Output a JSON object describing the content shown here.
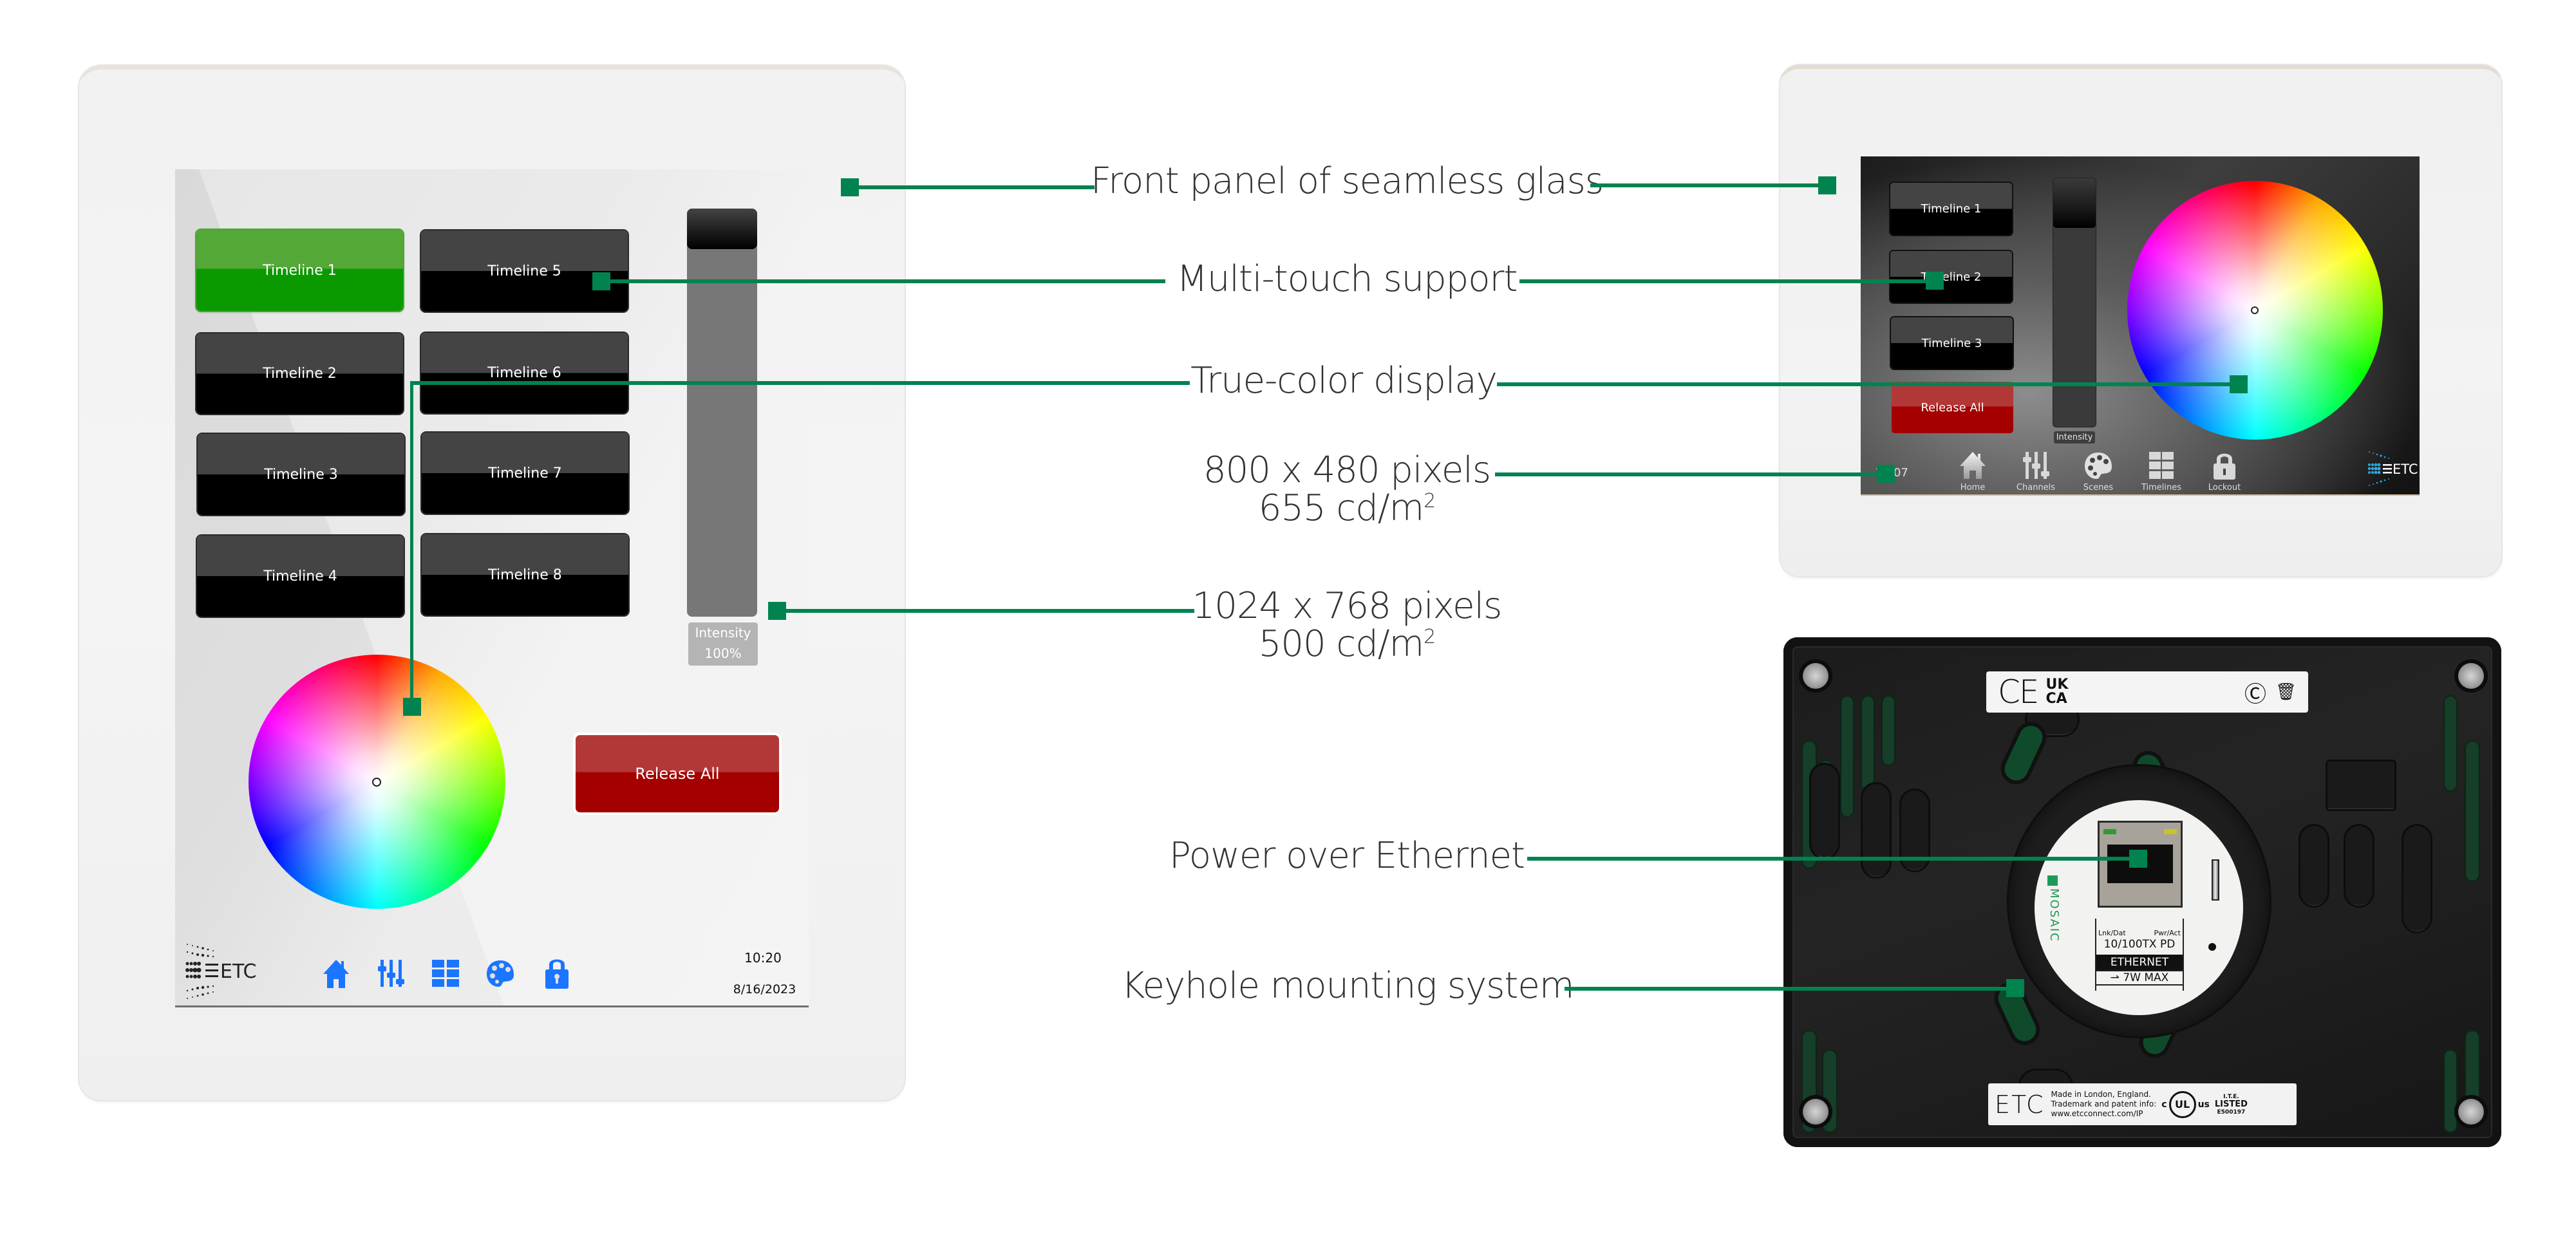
{
  "callouts": {
    "front_panel": "Front panel of seamless glass",
    "multi_touch": "Multi-touch support",
    "true_color": "True-color display",
    "small_res_line1": "800 x 480 pixels",
    "small_res_line2": "655 cd/m",
    "small_res_sup": "2",
    "large_res_line1": "1024 x 768 pixels",
    "large_res_line2": "500 cd/m",
    "large_res_sup": "2",
    "poe": "Power over Ethernet",
    "keyhole": "Keyhole mounting system"
  },
  "accent_color": "#00834f",
  "left_device": {
    "timelines": [
      {
        "label": "Timeline 1",
        "active": true
      },
      {
        "label": "Timeline 2",
        "active": false
      },
      {
        "label": "Timeline 3",
        "active": false
      },
      {
        "label": "Timeline 4",
        "active": false
      },
      {
        "label": "Timeline 5",
        "active": false
      },
      {
        "label": "Timeline 6",
        "active": false
      },
      {
        "label": "Timeline 7",
        "active": false
      },
      {
        "label": "Timeline 8",
        "active": false
      }
    ],
    "intensity_label": "Intensity",
    "intensity_value": "100%",
    "intensity_fraction": 1.0,
    "release_all": "Release All",
    "logo": "ETC",
    "nav_icons": [
      "home-icon",
      "channels-sliders-icon",
      "timelines-grid-icon",
      "scenes-palette-icon",
      "lockout-lock-icon"
    ],
    "time": "10:20",
    "date": "8/16/2023",
    "nav_color": "#1a75ff",
    "active_color": "#0a9a00",
    "release_color": "#a50000"
  },
  "right_device": {
    "timelines": [
      "Timeline 1",
      "Timeline 2",
      "Timeline 3"
    ],
    "release_all": "Release All",
    "intensity_label": "Intensity",
    "time": "12:07",
    "nav": [
      {
        "icon": "home-icon",
        "label": "Home"
      },
      {
        "icon": "channels-sliders-icon",
        "label": "Channels"
      },
      {
        "icon": "scenes-palette-icon",
        "label": "Scenes"
      },
      {
        "icon": "timelines-grid-icon",
        "label": "Timelines"
      },
      {
        "icon": "lockout-lock-icon",
        "label": "Lockout"
      }
    ],
    "logo": "ETC"
  },
  "back_panel": {
    "top_label": {
      "ce": "CE",
      "ukca_line1": "UK",
      "ukca_line2": "CA"
    },
    "mosaic_brand": "MOSAIC",
    "eth_indicators": {
      "left": "Lnk/Dat",
      "right": "Pwr/Act"
    },
    "eth_spec": "10/100TX PD",
    "eth_title": "ETHERNET",
    "eth_power": "7W MAX",
    "bottom_label": {
      "logo": "ETC",
      "line1": "Made in London, England.",
      "line2": "Trademark and patent info:",
      "line3": "www.etcconnect.com/IP",
      "ul_c": "c",
      "ul_mark": "UL",
      "ul_us": "us",
      "ite": "I.T.E.",
      "listed": "LISTED",
      "file_no": "E500197"
    }
  }
}
